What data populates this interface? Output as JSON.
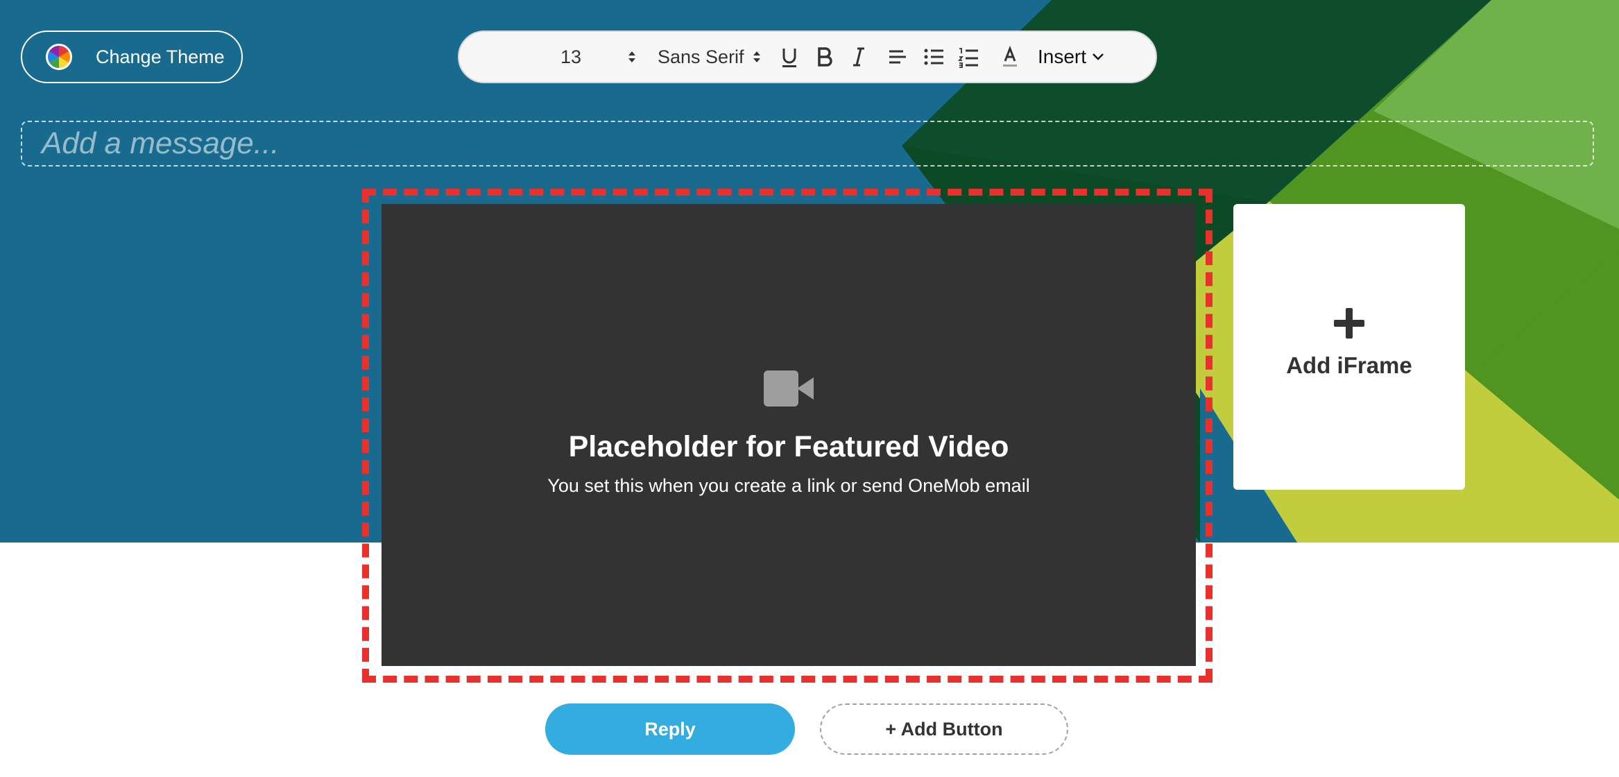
{
  "theme": {
    "label": "Change Theme",
    "icon": "palette-icon"
  },
  "toolbar": {
    "font_size": "13",
    "font_family": "Sans Serif",
    "insert_label": "Insert",
    "icons": [
      "size-stepper-icon",
      "font-dropdown-icon",
      "underline-icon",
      "bold-icon",
      "italic-icon",
      "align-left-icon",
      "bullet-list-icon",
      "numbered-list-icon",
      "text-color-icon",
      "chevron-down-icon"
    ]
  },
  "message": {
    "placeholder": "Add a message..."
  },
  "video": {
    "title": "Placeholder for Featured Video",
    "subtitle": "You set this when you create a link or send OneMob email",
    "icon": "video-camera-icon"
  },
  "iframe": {
    "label": "Add iFrame",
    "icon": "plus-icon"
  },
  "actions": {
    "reply_label": "Reply",
    "add_button_label": "+ Add Button"
  },
  "colors": {
    "hero_blue": "#186b8e",
    "reply_blue": "#33ade0",
    "dash_red": "#e8312c",
    "video_bg": "#333333"
  }
}
